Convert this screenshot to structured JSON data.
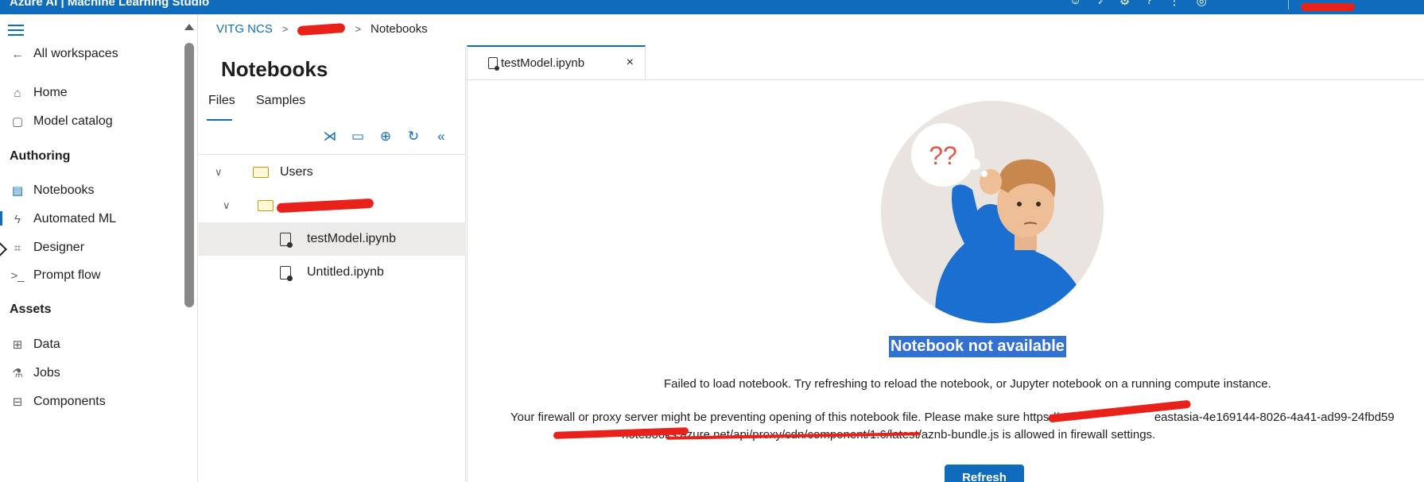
{
  "app": {
    "title": "Azure AI | Machine Learning Studio"
  },
  "topbar": {
    "icons": [
      "smiley-icon",
      "bell-icon",
      "gear-icon",
      "question-icon",
      "feedback-icon",
      "help-icon"
    ]
  },
  "leftnav": {
    "all_workspaces": "All workspaces",
    "home": "Home",
    "model_catalog": "Model catalog",
    "authoring_section": "Authoring",
    "notebooks": "Notebooks",
    "automated_ml": "Automated ML",
    "designer": "Designer",
    "prompt_flow": "Prompt flow",
    "assets_section": "Assets",
    "data": "Data",
    "jobs": "Jobs",
    "components": "Components"
  },
  "breadcrumb": {
    "workspace": "VITG NCS",
    "current": "Notebooks"
  },
  "filepanel": {
    "title": "Notebooks",
    "tab_files": "Files",
    "tab_samples": "Samples",
    "tree": {
      "users_folder": "Users",
      "file_1": "testModel.ipynb",
      "file_2": "Untitled.ipynb"
    }
  },
  "editor": {
    "tab_name": "testModel.ipynb",
    "tab_close": "×"
  },
  "content": {
    "illustration_text": "??",
    "heading": "Notebook not available",
    "message_1": "Failed to load notebook. Try refreshing to reload the notebook, or Jupyter notebook on a running compute instance.",
    "message_2_part1": "Your firewall or proxy server might be preventing opening of this notebook file. Please make sure https://",
    "message_2_part2": "eastasia-4e169144-8026-4a41-ad99-24fbd59",
    "message_2_part3": "notebooks.azure.net/api/proxy/cdn/component/1.6/latest/aznb-bundle.js is allowed in firewall settings.",
    "refresh_button": "Refresh"
  },
  "colors": {
    "accent": "#0f6cbd",
    "highlight": "#3271d1",
    "redaction": "#e8221b"
  }
}
